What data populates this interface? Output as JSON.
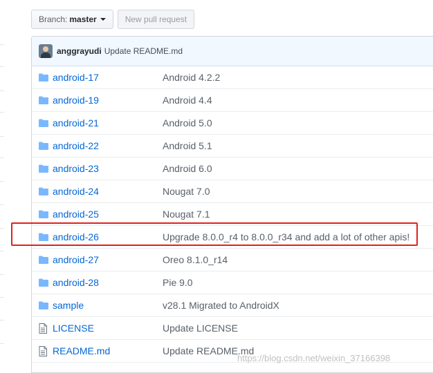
{
  "toolbar": {
    "branch_label": "Branch:",
    "branch_value": "master",
    "new_pr_label": "New pull request"
  },
  "commit": {
    "author": "anggrayudi",
    "message": "Update README.md"
  },
  "files": [
    {
      "name": "android-17",
      "message": "Android 4.2.2",
      "type": "folder"
    },
    {
      "name": "android-19",
      "message": "Android 4.4",
      "type": "folder"
    },
    {
      "name": "android-21",
      "message": "Android 5.0",
      "type": "folder"
    },
    {
      "name": "android-22",
      "message": "Android 5.1",
      "type": "folder"
    },
    {
      "name": "android-23",
      "message": "Android 6.0",
      "type": "folder"
    },
    {
      "name": "android-24",
      "message": "Nougat 7.0",
      "type": "folder"
    },
    {
      "name": "android-25",
      "message": "Nougat 7.1",
      "type": "folder"
    },
    {
      "name": "android-26",
      "message": "Upgrade 8.0.0_r4 to 8.0.0_r34 and add a lot of other apis!",
      "type": "folder"
    },
    {
      "name": "android-27",
      "message": "Oreo 8.1.0_r14",
      "type": "folder"
    },
    {
      "name": "android-28",
      "message": "Pie 9.0",
      "type": "folder"
    },
    {
      "name": "sample",
      "message": "v28.1 Migrated to AndroidX",
      "type": "folder"
    },
    {
      "name": "LICENSE",
      "message": "Update LICENSE",
      "type": "file"
    },
    {
      "name": "README.md",
      "message": "Update README.md",
      "type": "file"
    }
  ],
  "highlight_color": "#e0201b",
  "link_color": "#0366d6",
  "watermark": "https://blog.csdn.net/weixin_37166398"
}
